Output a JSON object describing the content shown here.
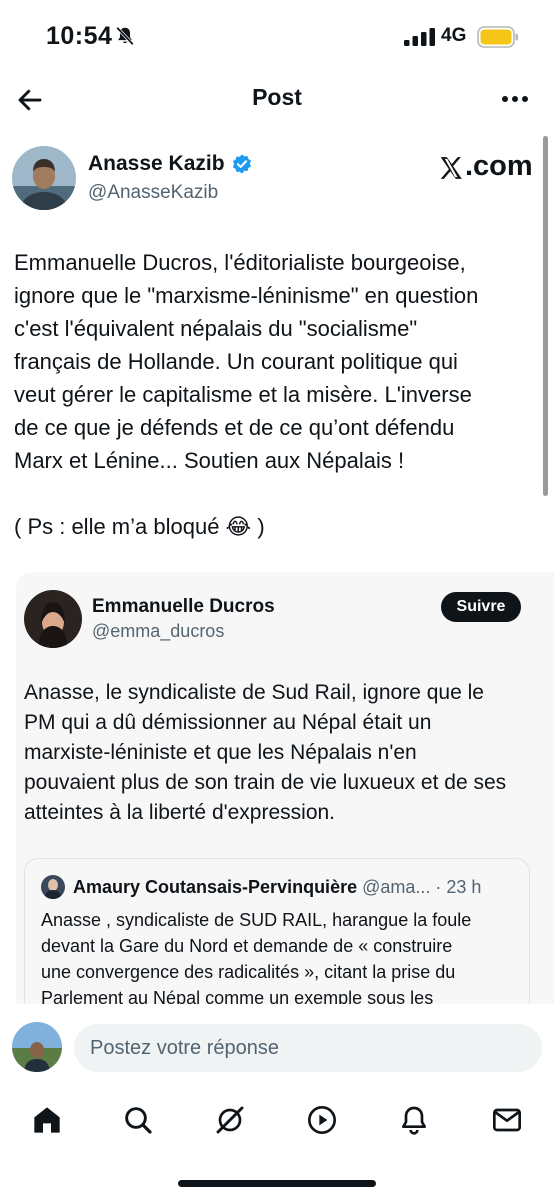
{
  "status_bar": {
    "time": "10:54",
    "network": "4G",
    "icons": [
      "bell-slash-icon",
      "signal-icon",
      "battery-icon"
    ],
    "battery_color": "#f5c518"
  },
  "header": {
    "title": "Post",
    "back_icon": "arrow-left-icon",
    "more_icon": "more-horizontal-icon"
  },
  "post": {
    "author_name": "Anasse Kazib",
    "author_handle": "@AnasseKazib",
    "verified": true,
    "watermark": ".com",
    "text": "Emmanuelle Ducros, l'éditorialiste bourgeoise,\nignore que le \"marxisme-léninisme\" en question\nc'est l'équivalent népalais du \"socialisme\"\nfrançais de Hollande. Un courant politique qui\nveut gérer le capitalisme et la misère. L'inverse\nde ce que je défends et de ce qu’ont défendu\nMarx et Lénine... Soutien aux Népalais !",
    "ps_text": "( Ps : elle m’a bloqué 😂 )"
  },
  "embedded": {
    "author_name": "Emmanuelle Ducros",
    "author_handle": "@emma_ducros",
    "follow_label": "Suivre",
    "text": "Anasse, le syndicaliste de Sud Rail, ignore que le\nPM qui a dû démissionner au Népal était un\nmarxiste-léniniste et que les Népalais n'en\npouvaient plus de son train de vie luxueux et de ses\natteintes à  la liberté d'expression.",
    "quote": {
      "author_name": "Amaury Coutansais-Pervinquière",
      "meta": " @ama... · 23 h",
      "text": "Anasse , syndicaliste de SUD RAIL, harangue la foule\ndevant la Gare du Nord et demande de « construire\nune convergence des radicalités », citant la prise du\nParlement au Népal comme un exemple sous les"
    }
  },
  "reply": {
    "placeholder": "Postez votre réponse"
  },
  "nav": {
    "items": [
      "home-icon",
      "search-icon",
      "grok-icon",
      "video-icon",
      "notifications-icon",
      "messages-icon"
    ]
  },
  "colors": {
    "accent": "#1d9bf0",
    "text": "#0f1419",
    "secondary": "#536471",
    "embed_bg": "#f7f7f8"
  }
}
